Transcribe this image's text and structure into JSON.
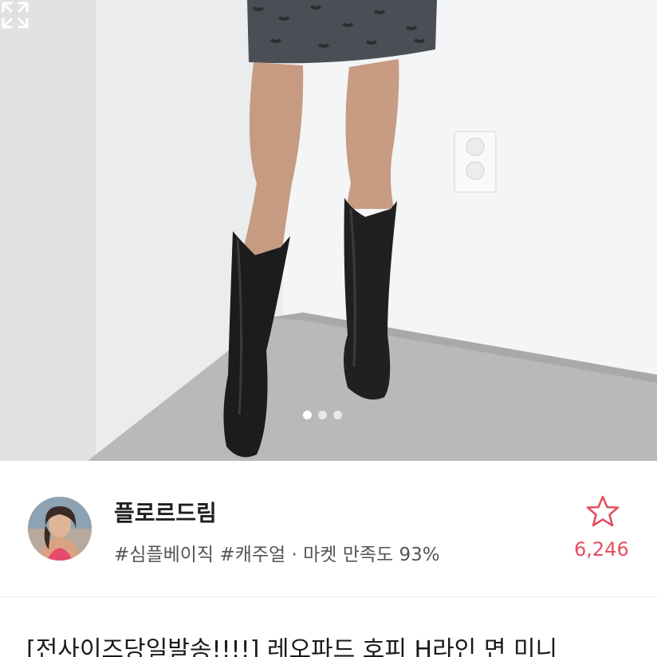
{
  "gallery": {
    "page_count": 3,
    "active_page": 1,
    "expand_icon": "expand-icon"
  },
  "shop": {
    "name": "플로르드림",
    "tags": "#심플베이직 #캐주얼 · 마켓 만족도 93%",
    "like_icon": "star-outline-icon",
    "like_count": "6,246",
    "accent_color": "#e2505f"
  },
  "product": {
    "title": "[전사이즈당일발송!!!!] 레오파드 호피 H라인 면 미니"
  }
}
